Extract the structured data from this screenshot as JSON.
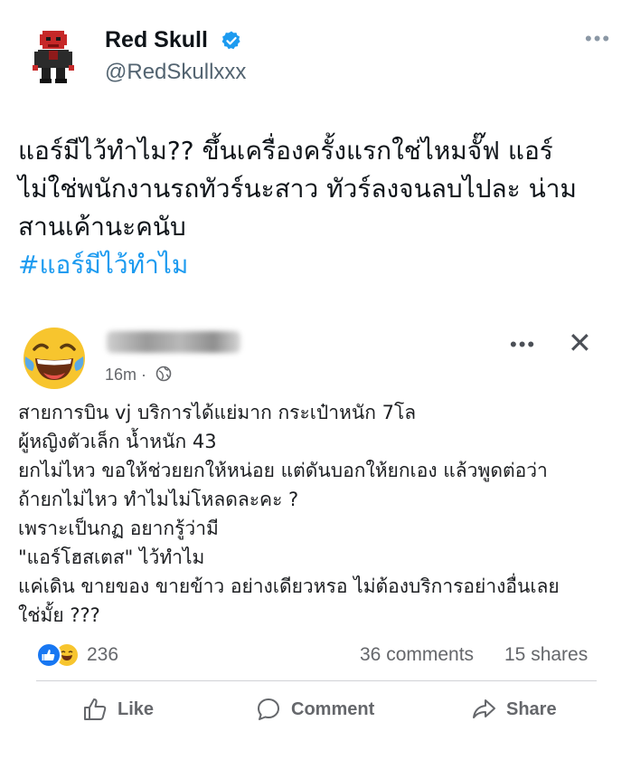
{
  "tweet": {
    "display_name": "Red Skull",
    "handle": "@RedSkullxxx",
    "more_icon": "more-horizontal-icon",
    "text_lines": [
      "แอร์มีไว้ทำไม?? ขึ้นเครื่องครั้งแรกใช่ไหมจั๊ฟ แอร์",
      "ไม่ใช่พนักงานรถทัวร์นะสาว ทัวร์ลงจนลบไปละ น่าม",
      "สานเค้านะคนับ"
    ],
    "hashtag": "#แอร์มีไว้ทำไม"
  },
  "facebook_post": {
    "time": "16m ·",
    "text_lines": [
      "สายการบิน vj บริการได้แย่มาก กระเป๋าหนัก 7โล",
      "ผู้หญิงตัวเล็ก น้ำหนัก 43",
      "ยกไม่ไหว ขอให้ช่วยยกให้หน่อย แต่ดันบอกให้ยกเอง แล้วพูดต่อว่า",
      "ถ้ายกไม่ไหว ทำไมไม่โหลดละคะ ?",
      "เพราะเป็นกฏ อยากรู้ว่ามี",
      "\"แอร์โฮสเตส\" ไว้ทำไม",
      "แค่เดิน ขายของ ขายข้าว อย่างเดียวหรอ ไม่ต้องบริการอย่างอื่นเลย",
      "ใช่มั้ย ???"
    ],
    "reaction_count": "236",
    "comments": "36 comments",
    "shares": "15 shares",
    "actions": {
      "like": "Like",
      "comment": "Comment",
      "share": "Share"
    }
  },
  "colors": {
    "hashtag": "#1d9bf0",
    "verified": "#1d9bf0",
    "fb_like": "#1877f2",
    "muted": "#65676b"
  }
}
